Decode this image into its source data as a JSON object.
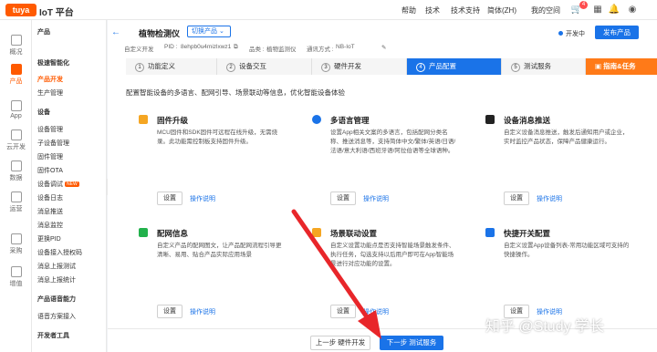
{
  "topbar": {
    "logo": "tuya",
    "brand": "IoT 平台",
    "nav": [
      "帮助",
      "技术",
      "技术支持",
      "简体(ZH)"
    ],
    "my_space": "我的空间",
    "cart_badge": "4"
  },
  "leftrail": [
    {
      "label": "概况",
      "icon": "overview-icon"
    },
    {
      "label": "产品",
      "icon": "product-icon",
      "active": true
    },
    {
      "label": "App",
      "icon": "app-icon"
    },
    {
      "label": "云开发",
      "icon": "cloud-icon"
    },
    {
      "label": "数据",
      "icon": "data-icon"
    },
    {
      "label": "运营",
      "icon": "ops-icon"
    },
    {
      "label": "采购",
      "icon": "purchase-icon"
    },
    {
      "label": "增值",
      "icon": "value-icon"
    }
  ],
  "sidemenu": {
    "items": [
      {
        "label": "产品",
        "group": true
      },
      {
        "label": "极速智能化",
        "group": true
      },
      {
        "label": "产品开发",
        "selected": true
      },
      {
        "label": "生产管理"
      },
      {
        "label": "设备",
        "group": true
      },
      {
        "label": "设备管理"
      },
      {
        "label": "子设备管理"
      },
      {
        "label": "固件管理"
      },
      {
        "label": "固件OTA"
      },
      {
        "label": "设备调试",
        "new": "NEW"
      },
      {
        "label": "设备日志"
      },
      {
        "label": "消息推送"
      },
      {
        "label": "消息监控"
      },
      {
        "label": "更换PID"
      },
      {
        "label": "设备接入授权码"
      },
      {
        "label": "消息上报测试"
      },
      {
        "label": "消息上报统计"
      },
      {
        "label": "产品语音能力",
        "group": true
      },
      {
        "label": "语音方案接入"
      },
      {
        "label": "开发者工具",
        "group": true
      }
    ]
  },
  "header": {
    "title": "植物检测仪",
    "switch_label": "切换产品",
    "meta": {
      "mode": "自定义开发",
      "pid_label": "PID :",
      "pid": "8ehpb0u4mizlxwz1",
      "category_label": "品类 :",
      "category": "植物监测仪",
      "protocol_label": "通讯方式 :",
      "protocol": "NB-IoT"
    },
    "status": "开发中",
    "publish": "发布产品"
  },
  "steps": [
    {
      "num": "1",
      "label": "功能定义"
    },
    {
      "num": "2",
      "label": "设备交互"
    },
    {
      "num": "3",
      "label": "硬件开发"
    },
    {
      "num": "4",
      "label": "产品配置",
      "active": true
    },
    {
      "num": "5",
      "label": "测试服务"
    }
  ],
  "guide_label": "指南&任务",
  "intro": "配置智能设备的多语言、配网引导、场景联动等信息，优化智能设备体验",
  "cards": [
    {
      "title": "固件升级",
      "desc": "MCU固件和SDK固件可远程在线升级，无需烧录。此功能需控制板支持固件升级。",
      "btn": "设置",
      "link": "操作说明",
      "color": "#f5a623"
    },
    {
      "title": "多语言管理",
      "desc": "设置App相关文案的多语言，包括配网分类名称、推送消息等，支持简体中文/繁体/英语/日语/法语/意大利语/西班牙语/阿拉伯语等全球语种。",
      "btn": "设置",
      "link": "操作说明",
      "color": "#1a73e8"
    },
    {
      "title": "设备消息推送",
      "desc": "自定义设备消息推送，触发后通知用户或企业，实时监控产品状态，保障产品健康运行。",
      "btn": "设置",
      "link": "操作说明",
      "color": "#222"
    },
    {
      "title": "配网信息",
      "desc": "自定义产品的配网图文，让产品配网流程引导更清晰、易用、贴合产品实际应用场景",
      "btn": "设置",
      "link": "操作说明",
      "color": "#22b14c"
    },
    {
      "title": "场景联动设置",
      "desc": "自定义设置功能点是否支持智能场景触发条件、执行任务，勾选支持以后用户即可在App智能场景进行对应功能的设置。",
      "btn": "设置",
      "link": "操作说明",
      "color": "#f5a623"
    },
    {
      "title": "快捷开关配置",
      "desc": "自定义设置App设备列表-常用功能区域可支持的快捷操作。",
      "btn": "设置",
      "link": "操作说明",
      "color": "#1a73e8"
    }
  ],
  "footer": {
    "prev": "上一步 硬件开发",
    "next": "下一步 测试服务"
  },
  "watermark": "知乎 @Study 学长"
}
